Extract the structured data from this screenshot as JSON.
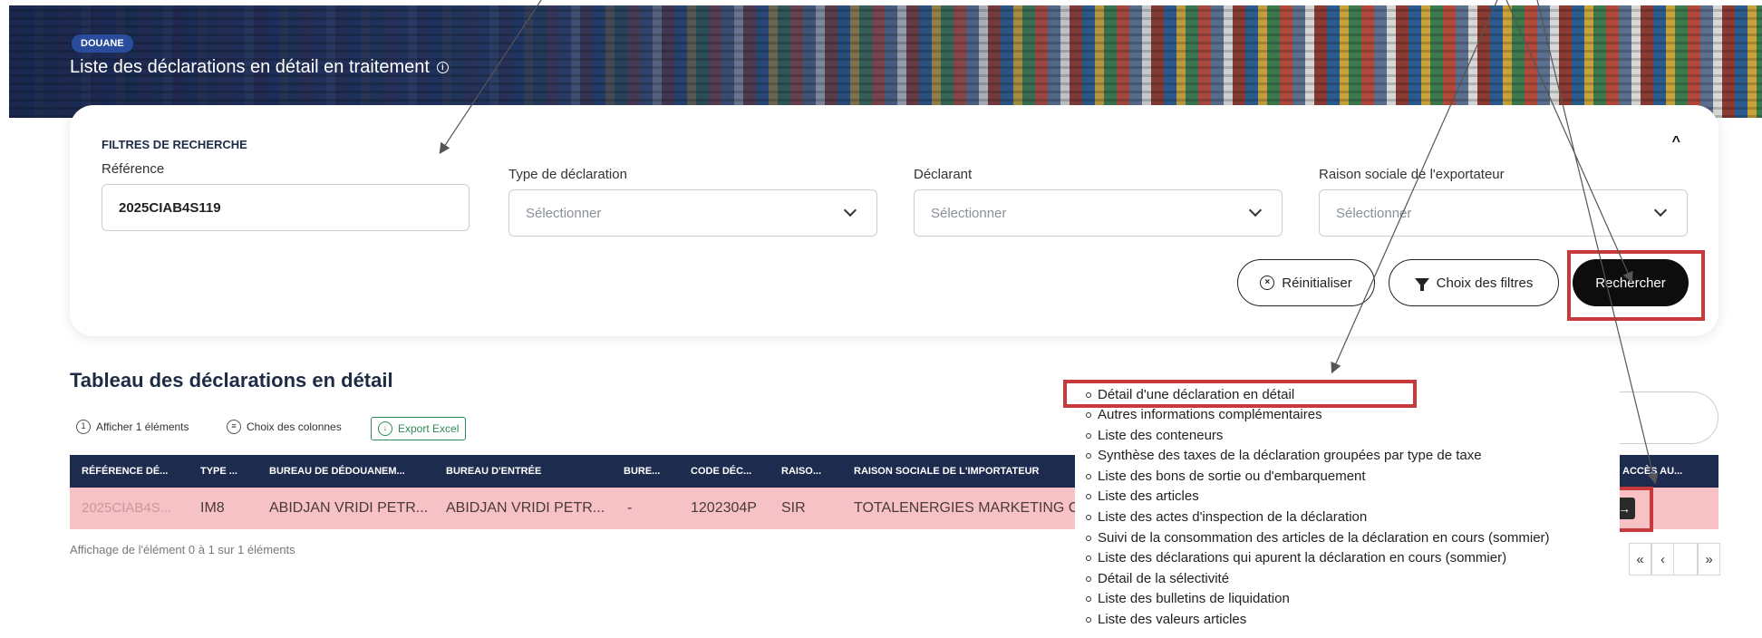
{
  "banner": {
    "tag": "DOUANE",
    "title": "Liste des déclarations en détail en traitement",
    "info_icon": "info-icon"
  },
  "filters": {
    "heading": "FILTRES DE RECHERCHE",
    "collapse_icon": "chevron-up-icon",
    "reference": {
      "label": "Référence",
      "value": "2025CIAB4S119"
    },
    "type_declaration": {
      "label": "Type de déclaration",
      "placeholder": "Sélectionner"
    },
    "declarant": {
      "label": "Déclarant",
      "placeholder": "Sélectionner"
    },
    "raison_sociale": {
      "label": "Raison sociale de l'exportateur",
      "placeholder": "Sélectionner"
    },
    "reset_label": "Réinitialiser",
    "filter_choice_label": "Choix des filtres",
    "search_label": "Rechercher"
  },
  "table": {
    "title": "Tableau des déclarations en détail",
    "tools": {
      "show_label": "Afficher 1 éléments",
      "columns_label": "Choix des colonnes",
      "export_label": "Export Excel"
    },
    "headers": [
      "RÉFÉRENCE DÉ...",
      "TYPE ...",
      "BUREAU DE DÉDOUANEM...",
      "BUREAU D'ENTRÉE",
      "BURE...",
      "CODE DÉC...",
      "RAISO...",
      "RAISON SOCIALE DE L'IMPORTATEUR",
      "ACCÈS AU..."
    ],
    "row": {
      "reference": "2025CIAB4S...",
      "type": "IM8",
      "bureau_dedouanement": "ABIDJAN VRIDI PETR...",
      "bureau_entree": "ABIDJAN VRIDI PETR...",
      "bureau": "-",
      "code_declarant": "1202304P",
      "raison": "SIR",
      "importateur": "TOTALENERGIES MARKETING C?I",
      "access_icon": "arrow-right-box-icon"
    },
    "pagination_text": "Affichage de l'élément 0 à 1 sur 1 éléments",
    "pager": [
      "«",
      "‹",
      "»"
    ]
  },
  "menu": {
    "items": [
      "Détail d'une déclaration en détail",
      "Autres informations complémentaires",
      "Liste des conteneurs",
      "Synthèse des taxes de la déclaration groupées par type de taxe",
      "Liste des bons de sortie ou d'embarquement",
      "Liste des articles",
      "Liste des actes d'inspection de la déclaration",
      "Suivi de la consommation des articles de la déclaration en cours (sommier)",
      "Liste des déclarations qui apurent la déclaration en cours (sommier)",
      "Détail de la sélectivité",
      "Liste des bulletins de liquidation",
      "Liste des valeurs articles"
    ]
  },
  "colors": {
    "navy": "#1d2b4f",
    "highlight_row": "#f6c2c5",
    "annotation_red": "#c8393b",
    "export_green": "#2e8b57"
  }
}
